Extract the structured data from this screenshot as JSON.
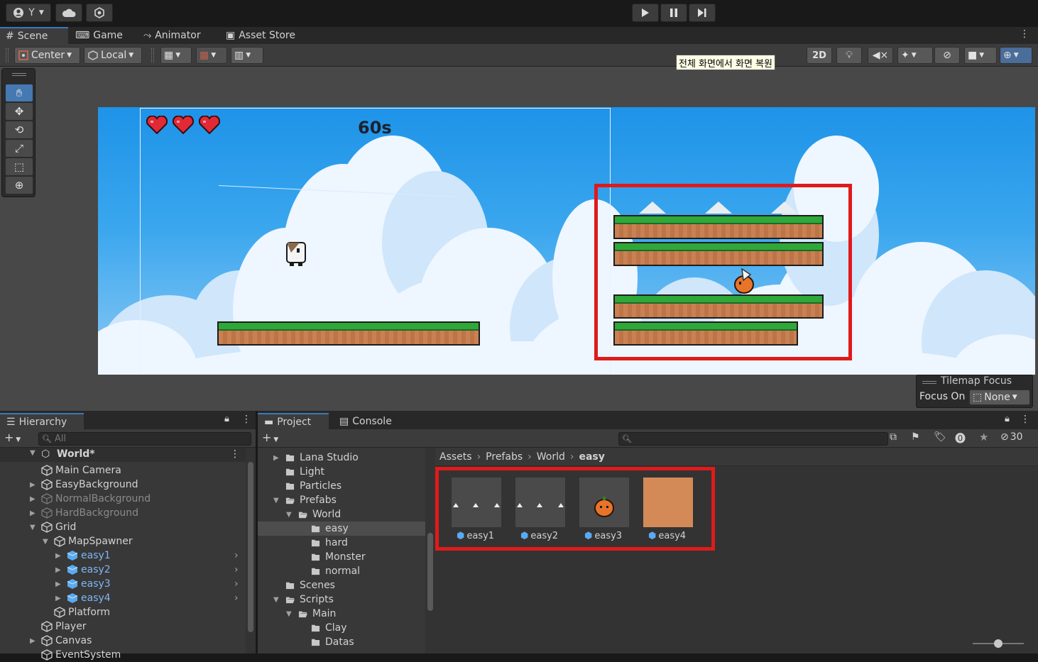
{
  "topbar": {
    "account_label": "Y",
    "cloud_icon": "cloud-icon",
    "settings_icon": "hexagon-gear-icon",
    "play_icon": "play-icon",
    "pause_icon": "pause-icon",
    "step_icon": "step-icon"
  },
  "scene_tabs": [
    {
      "label": "Scene",
      "icon": "grid-icon"
    },
    {
      "label": "Game",
      "icon": "gamepad-icon"
    },
    {
      "label": "Animator",
      "icon": "animator-icon"
    },
    {
      "label": "Asset Store",
      "icon": "bag-icon"
    }
  ],
  "toolbar": {
    "pivot_label": "Center",
    "space_label": "Local",
    "mode_2d_label": "2D",
    "tooltip": "전체 화면에서 화면 복원"
  },
  "game": {
    "timer": "60s",
    "hearts": 3
  },
  "tilemap_focus": {
    "title": "Tilemap Focus",
    "focus_label": "Focus On",
    "focus_value": "None"
  },
  "hierarchy": {
    "tab_label": "Hierarchy",
    "search_placeholder": "All",
    "root": "World*",
    "items": [
      {
        "label": "Main Camera",
        "depth": 1,
        "arrow": "",
        "style": "normal"
      },
      {
        "label": "EasyBackground",
        "depth": 1,
        "arrow": "▶",
        "style": "normal"
      },
      {
        "label": "NormalBackground",
        "depth": 1,
        "arrow": "▶",
        "style": "grey"
      },
      {
        "label": "HardBackground",
        "depth": 1,
        "arrow": "▶",
        "style": "grey"
      },
      {
        "label": "Grid",
        "depth": 1,
        "arrow": "▼",
        "style": "normal"
      },
      {
        "label": "MapSpawner",
        "depth": 2,
        "arrow": "▼",
        "style": "normal"
      },
      {
        "label": "easy1",
        "depth": 3,
        "arrow": "▶",
        "style": "prefab"
      },
      {
        "label": "easy2",
        "depth": 3,
        "arrow": "▶",
        "style": "prefab"
      },
      {
        "label": "easy3",
        "depth": 3,
        "arrow": "▶",
        "style": "prefab"
      },
      {
        "label": "easy4",
        "depth": 3,
        "arrow": "▶",
        "style": "prefab"
      },
      {
        "label": "Platform",
        "depth": 2,
        "arrow": "",
        "style": "normal"
      },
      {
        "label": "Player",
        "depth": 1,
        "arrow": "",
        "style": "normal"
      },
      {
        "label": "Canvas",
        "depth": 1,
        "arrow": "▶",
        "style": "normal"
      },
      {
        "label": "EventSystem",
        "depth": 1,
        "arrow": "",
        "style": "normal"
      }
    ]
  },
  "project": {
    "tab_label": "Project",
    "console_label": "Console",
    "hidden_count": "30",
    "tree": [
      {
        "label": "Lana Studio",
        "depth": 1,
        "arrow": "▶",
        "open": false,
        "selected": false
      },
      {
        "label": "Light",
        "depth": 1,
        "arrow": "",
        "open": false,
        "selected": false
      },
      {
        "label": "Particles",
        "depth": 1,
        "arrow": "",
        "open": false,
        "selected": false
      },
      {
        "label": "Prefabs",
        "depth": 1,
        "arrow": "▼",
        "open": true,
        "selected": false
      },
      {
        "label": "World",
        "depth": 2,
        "arrow": "▼",
        "open": true,
        "selected": false
      },
      {
        "label": "easy",
        "depth": 3,
        "arrow": "",
        "open": false,
        "selected": true
      },
      {
        "label": "hard",
        "depth": 3,
        "arrow": "",
        "open": false,
        "selected": false
      },
      {
        "label": "Monster",
        "depth": 3,
        "arrow": "",
        "open": false,
        "selected": false
      },
      {
        "label": "normal",
        "depth": 3,
        "arrow": "",
        "open": false,
        "selected": false
      },
      {
        "label": "Scenes",
        "depth": 1,
        "arrow": "",
        "open": false,
        "selected": false
      },
      {
        "label": "Scripts",
        "depth": 1,
        "arrow": "▼",
        "open": true,
        "selected": false
      },
      {
        "label": "Main",
        "depth": 2,
        "arrow": "▼",
        "open": true,
        "selected": false
      },
      {
        "label": "Clay",
        "depth": 3,
        "arrow": "",
        "open": false,
        "selected": false
      },
      {
        "label": "Datas",
        "depth": 3,
        "arrow": "",
        "open": false,
        "selected": false
      }
    ],
    "breadcrumb": [
      "Assets",
      "Prefabs",
      "World",
      "easy"
    ],
    "assets": [
      {
        "label": "easy1"
      },
      {
        "label": "easy2"
      },
      {
        "label": "easy3"
      },
      {
        "label": "easy4"
      }
    ]
  }
}
